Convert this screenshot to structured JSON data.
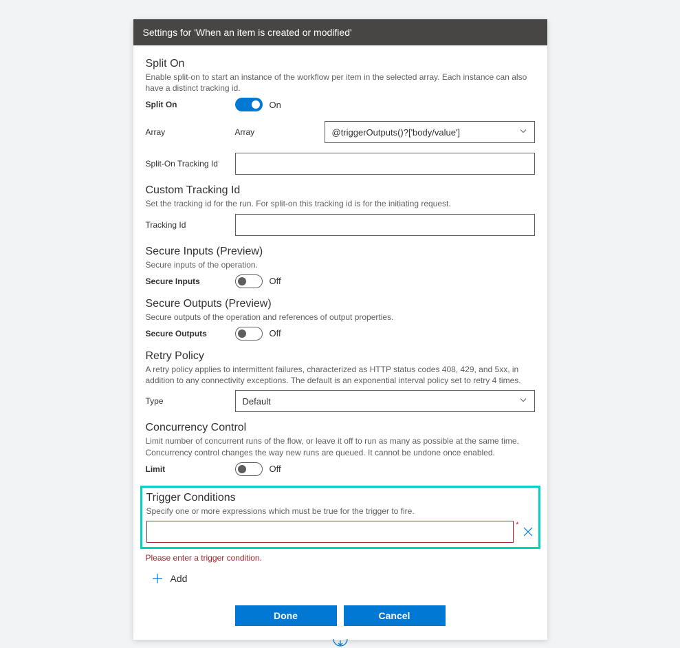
{
  "header": {
    "title": "Settings for 'When an item is created or modified'"
  },
  "splitOn": {
    "title": "Split On",
    "desc": "Enable split-on to start an instance of the workflow per item in the selected array. Each instance can also have a distinct tracking id.",
    "toggleLabel": "Split On",
    "toggleState": "On",
    "arrayLabel": "Array",
    "arraySubLabel": "Array",
    "arrayValue": "@triggerOutputs()?['body/value']",
    "trackingLabel": "Split-On Tracking Id",
    "trackingValue": ""
  },
  "customTracking": {
    "title": "Custom Tracking Id",
    "desc": "Set the tracking id for the run. For split-on this tracking id is for the initiating request.",
    "label": "Tracking Id",
    "value": ""
  },
  "secureInputs": {
    "title": "Secure Inputs (Preview)",
    "desc": "Secure inputs of the operation.",
    "label": "Secure Inputs",
    "state": "Off"
  },
  "secureOutputs": {
    "title": "Secure Outputs (Preview)",
    "desc": "Secure outputs of the operation and references of output properties.",
    "label": "Secure Outputs",
    "state": "Off"
  },
  "retryPolicy": {
    "title": "Retry Policy",
    "desc": "A retry policy applies to intermittent failures, characterized as HTTP status codes 408, 429, and 5xx, in addition to any connectivity exceptions. The default is an exponential interval policy set to retry 4 times.",
    "label": "Type",
    "value": "Default"
  },
  "concurrency": {
    "title": "Concurrency Control",
    "desc": "Limit number of concurrent runs of the flow, or leave it off to run as many as possible at the same time. Concurrency control changes the way new runs are queued. It cannot be undone once enabled.",
    "label": "Limit",
    "state": "Off"
  },
  "triggerConditions": {
    "title": "Trigger Conditions",
    "desc": "Specify one or more expressions which must be true for the trigger to fire.",
    "value": "",
    "error": "Please enter a trigger condition.",
    "addLabel": "Add"
  },
  "buttons": {
    "done": "Done",
    "cancel": "Cancel"
  }
}
